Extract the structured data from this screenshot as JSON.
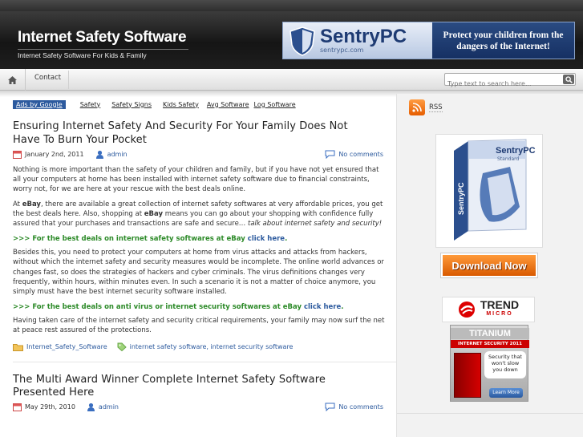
{
  "header": {
    "site_title": "Internet Safety Software",
    "tagline": "Internet Safety Software For Kids & Family",
    "banner": {
      "brand": "SentryPC",
      "url": "sentrypc.com",
      "slogan_line1": "Protect your children from the",
      "slogan_line2": "dangers of the Internet!"
    }
  },
  "nav": {
    "home_icon": "home-icon",
    "items": [
      {
        "label": "Contact"
      }
    ],
    "search_placeholder": "Type text to search here..."
  },
  "ads": {
    "label": "Ads by Google",
    "links": [
      "Safety",
      "Safety Signs",
      "Kids Safety",
      "Avg Software",
      "Log Software"
    ]
  },
  "posts": [
    {
      "title_line1": "Ensuring Internet Safety And Security For Your Family Does Not",
      "title_line2": "Have To Burn Your Pocket",
      "date": "January 2nd, 2011",
      "author": "admin",
      "comments": "No comments",
      "p1": "Nothing is more important than the safety of your children and family, but if you have not yet ensured that all your computers at home has been installed with internet safety software due to financial constraints, worry not, for we are here at your rescue with the best deals online.",
      "p2_pre": "At ",
      "p2_b1": "eBay",
      "p2_mid": ", there are available a great collection of internet safety softwares at very affordable prices, you get the best deals here. Also, shopping at ",
      "p2_b2": "eBay",
      "p2_post": " means you can go about your shopping with confidence fully assured that your purchases and transactions are safe and secure… ",
      "p2_italic": "talk about internet safety and security!",
      "green1": ">>> For the best deals on internet safety softwares at eBay",
      "green1_link": "click here",
      "p3": "Besides this, you need to protect your computers at home from virus attacks and attacks from hackers, without which the internet safety and security measures would be incomplete. The online world advances or changes fast, so does the strategies of hackers and cyber criminals. The virus definitions changes very frequently, within hours, within minutes even. In such a scenario it is not a matter of choice anymore, you simply must have the best internet security software installed.",
      "green2": ">>> For the best deals on anti virus or internet security softwares at eBay",
      "green2_link": "click here",
      "p4": "Having taken care of the internet safety and security critical requirements, your family may now surf the net at peace rest assured of the protections.",
      "category": "Internet_Safety_Software",
      "tags": "internet safety software, internet security software"
    },
    {
      "title_line1": "The Multi Award Winner Complete Internet Safety Software",
      "title_line2": "Presented Here",
      "date": "May 29th, 2010",
      "author": "admin",
      "comments": "No comments"
    }
  ],
  "sidebar": {
    "rss_label": "RSS",
    "product": {
      "brand": "SentryPC",
      "edition": "Standard"
    },
    "download_label": "Download Now",
    "trend": {
      "name": "TREND",
      "sub": "MICRO"
    },
    "titanium": {
      "line1": "TITANIUM",
      "line2": "INTERNET SECURITY 2011",
      "bubble": "Security that won't slow you down",
      "button": "Learn More"
    }
  },
  "colors": {
    "accent": "#2c5a9e",
    "green": "#2c8a28",
    "header_bg": "#1e1e1e"
  }
}
